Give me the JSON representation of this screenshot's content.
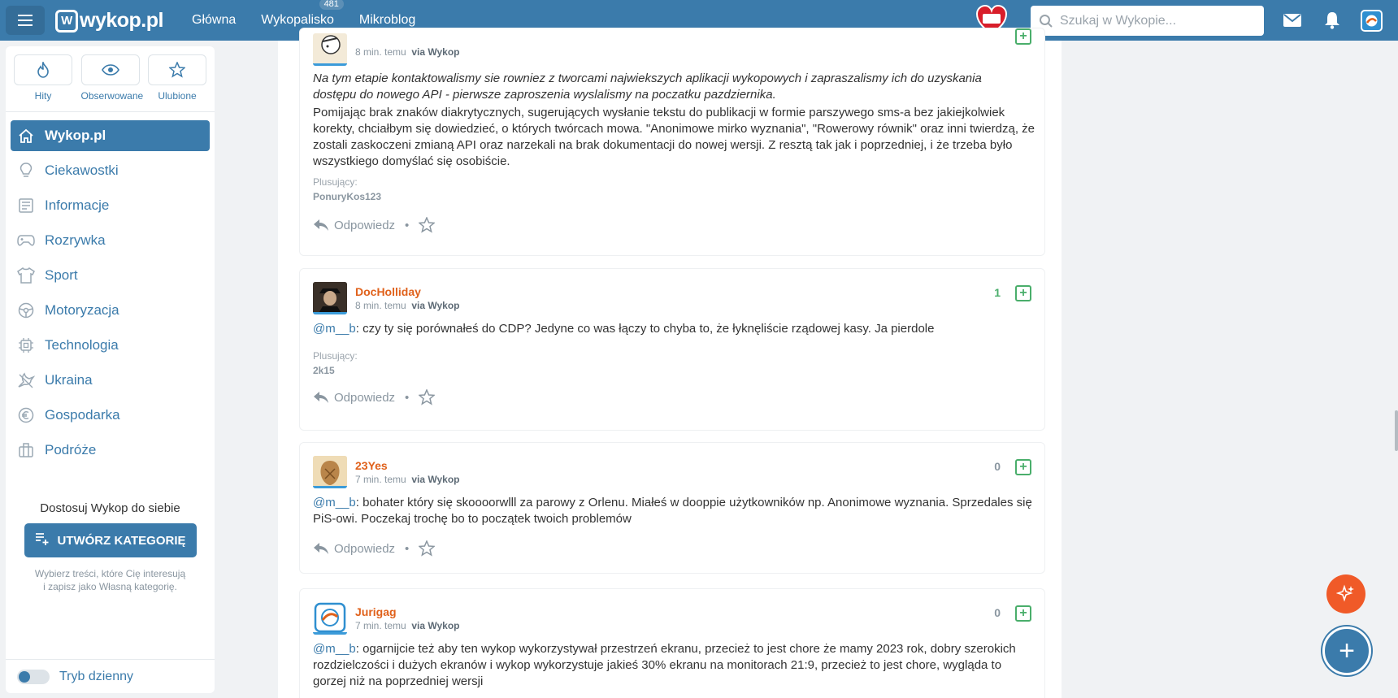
{
  "topbar": {
    "logo_text": "wykop.pl",
    "nav": [
      {
        "label": "Główna"
      },
      {
        "label": "Wykopalisko",
        "badge": "481"
      },
      {
        "label": "Mikroblog"
      }
    ],
    "search_placeholder": "Szukaj w Wykopie...",
    "heart_badge_text": "wielka orkiestra świątecznej pomocy"
  },
  "sidebar": {
    "quick": [
      {
        "label": "Hity",
        "icon": "flame-icon"
      },
      {
        "label": "Obserwowane",
        "icon": "eye-icon"
      },
      {
        "label": "Ulubione",
        "icon": "star-icon"
      }
    ],
    "categories": [
      {
        "label": "Wykop.pl",
        "icon": "home-icon",
        "active": true
      },
      {
        "label": "Ciekawostki",
        "icon": "bulb-icon"
      },
      {
        "label": "Informacje",
        "icon": "newspaper-icon"
      },
      {
        "label": "Rozrywka",
        "icon": "gamepad-icon"
      },
      {
        "label": "Sport",
        "icon": "shirt-icon"
      },
      {
        "label": "Motoryzacja",
        "icon": "steering-wheel-icon"
      },
      {
        "label": "Technologia",
        "icon": "chip-icon"
      },
      {
        "label": "Ukraina",
        "icon": "dove-icon"
      },
      {
        "label": "Gospodarka",
        "icon": "euro-icon"
      },
      {
        "label": "Podróże",
        "icon": "suitcase-icon"
      }
    ],
    "custom_title": "Dostosuj Wykop do siebie",
    "create_button": "UTWÓRZ KATEGORIĘ",
    "custom_desc_line1": "Wybierz treści, które Cię interesują",
    "custom_desc_line2": "i zapisz jako Własną kategorię.",
    "day_mode_label": "Tryb dzienny"
  },
  "comments": [
    {
      "author": "",
      "time": "8 min. temu",
      "via": "via Wykop",
      "italic_text": "Na tym etapie kontaktowalismy sie rowniez z tworcami najwiekszych aplikacji wykopowych i zapraszalismy ich do uzyskania dostępu do nowego API - pierwsze zaproszenia wyslalismy na poczatku pazdziernika.",
      "text": "Pomijając brak znaków diakrytycznych, sugerujących wysłanie tekstu do publikacji w formie parszywego sms-a bez jakiejkolwiek korekty, chciałbym się dowiedzieć, o których twórcach mowa. \"Anonimowe mirko wyznania\", \"Rowerowy równik\" oraz inni twierdzą, że zostali zaskoczeni zmianą API oraz narzekali na brak dokumentacji do nowej wersji. Z resztą tak jak i poprzedniej, i że trzeba było wszystkiego domyślać się osobiście.",
      "plusers_label": "Plusujący:",
      "plusers": "PonuryKos123",
      "reply": "Odpowiedz"
    },
    {
      "author": "DocHolliday",
      "time": "8 min. temu",
      "via": "via Wykop",
      "score": "1",
      "mention": "@m__b",
      "text": ": czy ty się porównałeś do CDP? Jedyne co was łączy to chyba to, że łyknęliście rządowej kasy. Ja pierdole",
      "plusers_label": "Plusujący:",
      "plusers": "2k15",
      "reply": "Odpowiedz"
    },
    {
      "author": "23Yes",
      "time": "7 min. temu",
      "via": "via Wykop",
      "score": "0",
      "mention": "@m__b",
      "text": ": bohater który się skoooorwlll za parowy z Orlenu. Miałeś w dooppie użytkowników np. Anonimowe wyznania. Sprzedales się PiS-owi. Poczekaj trochę bo to początek twoich problemów",
      "reply": "Odpowiedz"
    },
    {
      "author": "Jurigag",
      "time": "7 min. temu",
      "via": "via Wykop",
      "score": "0",
      "mention": "@m__b",
      "text": ": ogarnijcie też aby ten wykop wykorzystywał przestrzeń ekranu, przecież to jest chore że mamy 2023 rok, dobry szerokich rozdzielczości i dużych ekranów i wykop wykorzystuje jakieś 30% ekranu na monitorach 21:9, przecież to jest chore, wygląda to gorzej niż na poprzedniej wersji"
    }
  ],
  "colors": {
    "brand": "#3b7bab",
    "author": "#e0611b",
    "plus": "#4aae6b",
    "fab_orange": "#f05a28"
  }
}
